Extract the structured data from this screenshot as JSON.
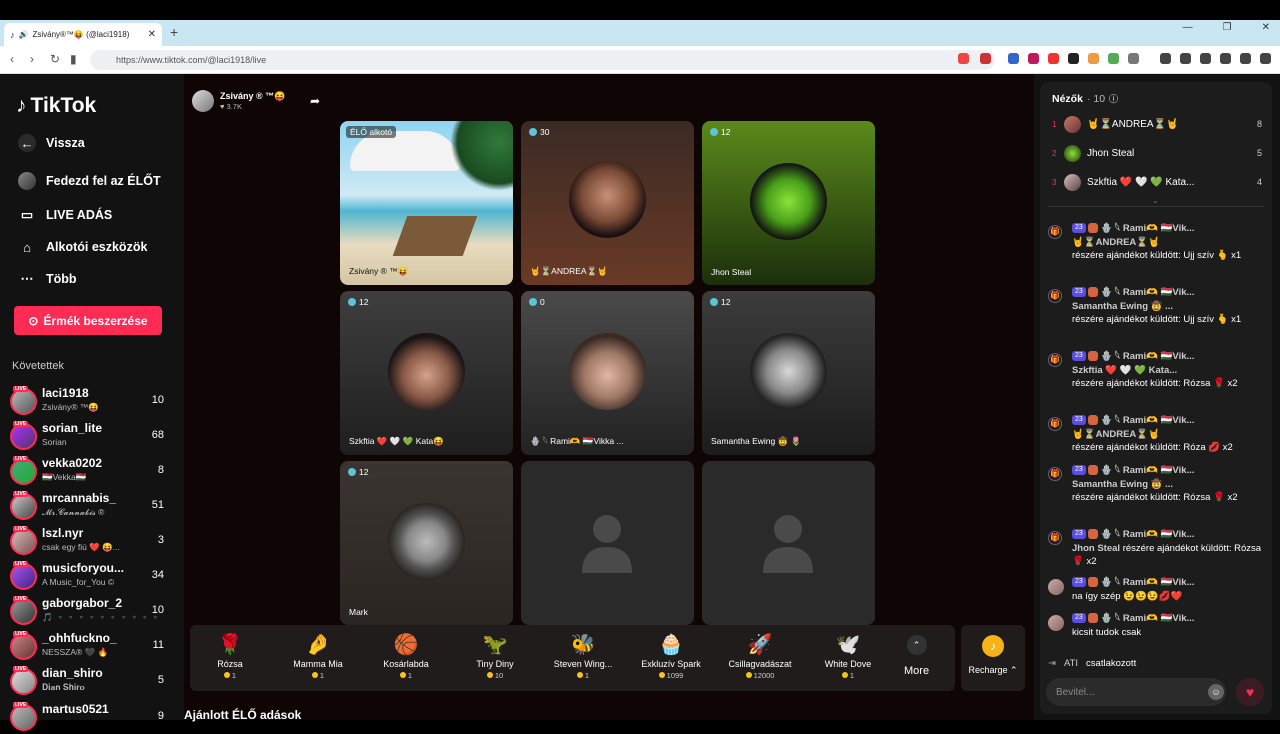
{
  "browser": {
    "tab_title": "Zsivány®™😝 (@laci1918) É...",
    "url": "https://www.tiktok.com/@laci1918/live",
    "new_tab": "+",
    "close_tab": "✕"
  },
  "sidebar": {
    "logo": "TikTok",
    "back": "Vissza",
    "explore_live": "Fedezd fel az ÉLŐT",
    "live_broadcast": "LIVE ADÁS",
    "creator_tools": "Alkotói eszközök",
    "more": "Több",
    "buy_coins": "Érmék beszerzése",
    "following_title": "Követettek",
    "live_tag": "LIVE",
    "following": [
      {
        "name": "laci1918",
        "sub": "Zsivány® ™😝",
        "count": "10"
      },
      {
        "name": "sorian_lite",
        "sub": "Sorian",
        "count": "68"
      },
      {
        "name": "vekka0202",
        "sub": "🇭🇺Vekka🇭🇺",
        "count": "8"
      },
      {
        "name": "mrcannabis_",
        "sub": "𝓜𝓻.𝓒𝓪𝓷𝓷𝓪𝓫𝓲𝓼 ®",
        "count": "51"
      },
      {
        "name": "lszl.nyr",
        "sub": "csak egy fiú ❤️ 😝...",
        "count": "3"
      },
      {
        "name": "musicforyou...",
        "sub": "A Music_for_You ©",
        "count": "34"
      },
      {
        "name": "gaborgabor_2",
        "sub": "🎵 ▪️▪️▪️▪️▪️▪️▪️▪️▪️▪️",
        "count": "10"
      },
      {
        "name": "_ohhfuckno_",
        "sub": "NESSZA® 🖤 🔥",
        "count": "11"
      },
      {
        "name": "dian_shiro",
        "sub": "𝐃𝐢𝐚𝐧 𝐒𝐡𝐢𝐫𝐨",
        "count": "5"
      },
      {
        "name": "martus0521",
        "sub": "",
        "count": "9"
      }
    ]
  },
  "host": {
    "name": "Zsivány ® ™😝",
    "likes": "♥ 3.7K"
  },
  "grid": {
    "host_label": "ÉLŐ alkotó",
    "host_name": "Zsivány ® ™😝",
    "cells": [
      {
        "count": "30",
        "name": "🤘⏳ANDREA⏳🤘"
      },
      {
        "count": "12",
        "name": "Jhon Steal"
      },
      {
        "count": "12",
        "name": "Szkftia ❤️ 🤍 💚 Kata😝"
      },
      {
        "count": "0",
        "name": "🪬 𓆩 Rami🫶 🇭🇺Vikka ..."
      },
      {
        "count": "12",
        "name": "Samantha Ewing 🤠 🌷"
      },
      {
        "count": "12",
        "name": "Mark"
      }
    ]
  },
  "gifts": [
    {
      "name": "Rózsa",
      "price": "1",
      "icon": "🌹"
    },
    {
      "name": "Mamma Mia",
      "price": "1",
      "icon": "🤌"
    },
    {
      "name": "Kosárlabda",
      "price": "1",
      "icon": "🏀"
    },
    {
      "name": "Tiny Diny",
      "price": "10",
      "icon": "🦖"
    },
    {
      "name": "Steven Wing...",
      "price": "1",
      "icon": "🐝"
    },
    {
      "name": "Exkluzív Spark",
      "price": "1099",
      "icon": "🧁"
    },
    {
      "name": "Csillagvadászat",
      "price": "12000",
      "icon": "🚀"
    },
    {
      "name": "White Dove",
      "price": "1",
      "icon": "🕊️"
    }
  ],
  "more_label": "More",
  "recharge_label": "Recharge ⌃",
  "suggested": "Ajánlott ÉLŐ adások",
  "viewers": {
    "title": "Nézők",
    "count": "· 10",
    "list": [
      {
        "rank": "1",
        "name": "🤘⏳ANDREA⏳🤘",
        "score": "8"
      },
      {
        "rank": "2",
        "name": "Jhon Steal",
        "score": "5"
      },
      {
        "rank": "3",
        "name": "Szkftia ❤️ 🤍 💚 Kata...",
        "score": "4"
      }
    ]
  },
  "chat": [
    {
      "level": "23",
      "user": "🪬 𓆩 Rami🫶 🇭🇺Vik...",
      "target": "🤘⏳ANDREA⏳🤘",
      "text": "részére ajándékot küldött: Ujj szív 🫰 x1"
    },
    {
      "level": "23",
      "user": "🪬 𓆩 Rami🫶 🇭🇺Vik...",
      "target": "Samantha Ewing 🤠 ...",
      "text": "részére ajándékot küldött: Ujj szív 🫰 x1"
    },
    {
      "level": "23",
      "user": "🪬 𓆩 Rami🫶 🇭🇺Vik...",
      "target": "Szkftia ❤️ 🤍 💚 Kata...",
      "text": "részére ajándékot küldött: Rózsa 🌹 x2"
    },
    {
      "level": "23",
      "user": "🪬 𓆩 Rami🫶 🇭🇺Vik...",
      "target": "🤘⏳ANDREA⏳🤘",
      "text": "részére ajándékot küldött: Róza 💋 x2"
    },
    {
      "level": "23",
      "user": "🪬 𓆩 Rami🫶 🇭🇺Vik...",
      "target": "Samantha Ewing 🤠 ...",
      "text": "részére ajándékot küldött: Rózsa 🌹 x2"
    },
    {
      "level": "23",
      "user": "🪬 𓆩 Rami🫶 🇭🇺Vik...",
      "target": "Jhon Steal",
      "text": "részére ajándékot küldött: Rózsa 🌹 x2"
    },
    {
      "level": "23",
      "user": "🪬 𓆩 Rami🫶 🇭🇺Vik...",
      "target": "",
      "text": "na így szép 😉😉😉💋❤️"
    },
    {
      "level": "23",
      "user": "🪬 𓆩 Rami🫶 🇭🇺Vik...",
      "target": "",
      "text": "kicsit tudok csak"
    }
  ],
  "join": {
    "user": "ATI",
    "text": "csatlakozott"
  },
  "input_placeholder": "Bevitel...",
  "colors": {
    "accent": "#fe2c55",
    "panel": "#1c1c1c"
  }
}
